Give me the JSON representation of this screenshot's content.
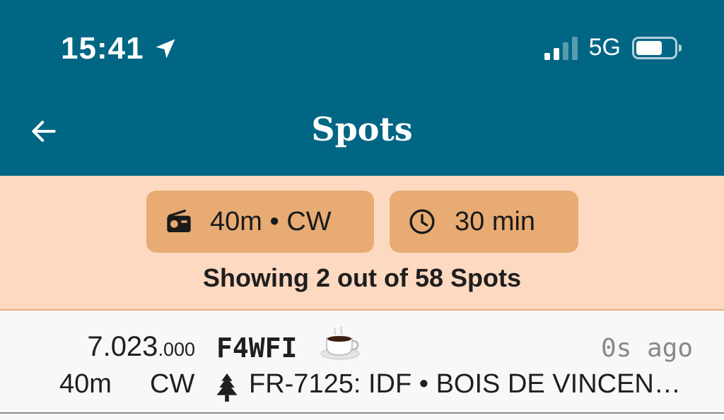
{
  "status_bar": {
    "time": "15:41",
    "network": "5G",
    "location_icon": "location-arrow-icon",
    "signal_icon": "cellular-signal-icon",
    "battery_icon": "battery-icon"
  },
  "header": {
    "title": "Spots",
    "back_icon": "back-arrow-icon"
  },
  "filters": {
    "band_mode_chip": {
      "label": "40m • CW",
      "icon": "radio-icon"
    },
    "time_chip": {
      "label": "30 min",
      "icon": "clock-icon"
    },
    "summary": "Showing 2 out of 58 Spots"
  },
  "spots": [
    {
      "freq_mhz": "7.023",
      "freq_khz": ".000",
      "callsign": "F4WFI",
      "status_emoji_icon": "coffee-cup-icon",
      "age": "0s ago",
      "band": "40m",
      "mode": "CW",
      "park_icon": "pine-tree-icon",
      "park": "FR-7125: IDF • BOIS DE VINCEN…"
    }
  ],
  "colors": {
    "header_bg": "#006684",
    "filter_bg": "#fdd9c1",
    "chip_bg": "#e7ab73",
    "list_bg": "#f7f8fa",
    "muted_text": "#888888"
  }
}
